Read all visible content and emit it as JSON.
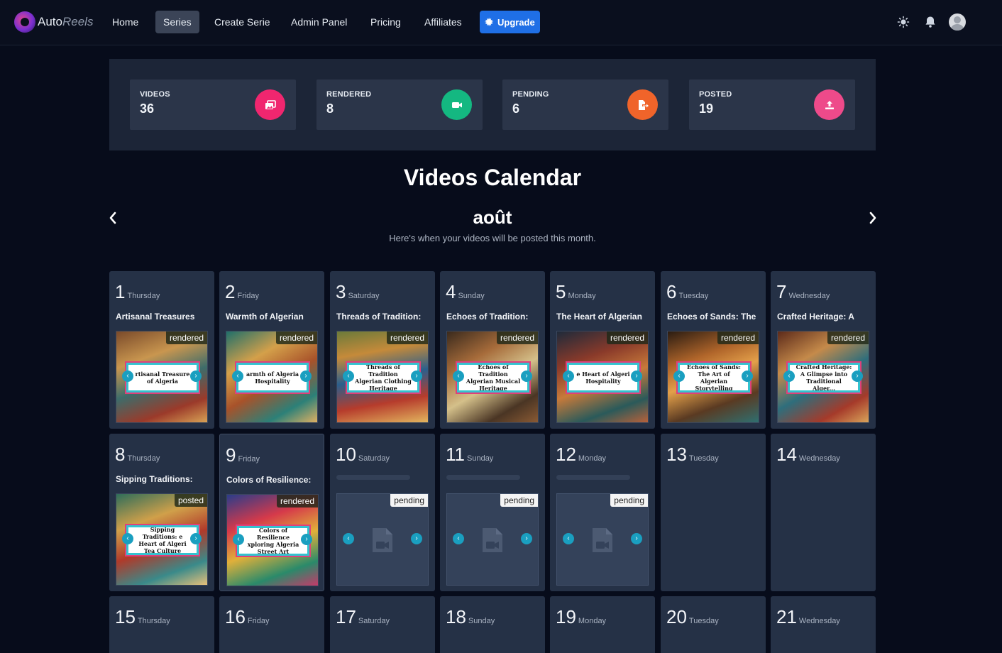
{
  "app": {
    "logo_main": "Auto",
    "logo_accent": "Reels"
  },
  "nav": {
    "items": [
      {
        "label": "Home",
        "active": false
      },
      {
        "label": "Series",
        "active": true
      },
      {
        "label": "Create Serie",
        "active": false
      },
      {
        "label": "Admin Panel",
        "active": false
      },
      {
        "label": "Pricing",
        "active": false
      },
      {
        "label": "Affiliates",
        "active": false
      }
    ],
    "upgrade_label": "Upgrade",
    "icons": [
      "sun-icon",
      "bell-icon",
      "avatar"
    ]
  },
  "stats": [
    {
      "label": "VIDEOS",
      "value": "36",
      "color": "#f0266f",
      "icon": "images-icon"
    },
    {
      "label": "RENDERED",
      "value": "8",
      "color": "#14b881",
      "icon": "video-icon"
    },
    {
      "label": "PENDING",
      "value": "6",
      "color": "#f0642a",
      "icon": "file-export-icon"
    },
    {
      "label": "POSTED",
      "value": "19",
      "color": "#ee4a8a",
      "icon": "upload-icon"
    }
  ],
  "calendar": {
    "title": "Videos Calendar",
    "month": "août",
    "subtitle": "Here's when your videos will be posted this month.",
    "days": [
      {
        "num": "1",
        "name": "Thursday",
        "title": "Artisanal Treasures",
        "status": "rendered",
        "caption": "rtisanal Treasure of Algeria"
      },
      {
        "num": "2",
        "name": "Friday",
        "title": "Warmth of Algerian",
        "status": "rendered",
        "caption": "armth of Algeria Hospitality"
      },
      {
        "num": "3",
        "name": "Saturday",
        "title": "Threads of Tradition:",
        "status": "rendered",
        "caption": "Threads of Tradition Algerian Clothing Heritage"
      },
      {
        "num": "4",
        "name": "Sunday",
        "title": "Echoes of Tradition:",
        "status": "rendered",
        "caption": "Echoes of Tradition Algerian Musical Heritage"
      },
      {
        "num": "5",
        "name": "Monday",
        "title": "The Heart of Algerian",
        "status": "rendered",
        "caption": "e Heart of Algeri Hospitality"
      },
      {
        "num": "6",
        "name": "Tuesday",
        "title": "Echoes of Sands: The",
        "status": "rendered",
        "caption": "Echoes of Sands: The Art of Algerian Storytelling"
      },
      {
        "num": "7",
        "name": "Wednesday",
        "title": "Crafted Heritage: A",
        "status": "rendered",
        "caption": "Crafted Heritage: A Glimpse into Traditional Alger..."
      },
      {
        "num": "8",
        "name": "Thursday",
        "title": "Sipping Traditions:",
        "status": "posted",
        "caption": "Sipping Traditions: e Heart of Algeri Tea Culture"
      },
      {
        "num": "9",
        "name": "Friday",
        "title": "Colors of Resilience:",
        "status": "rendered",
        "caption": "Colors of Resilience xploring Algeria Street Art"
      },
      {
        "num": "10",
        "name": "Saturday",
        "title": "",
        "status": "pending",
        "caption": ""
      },
      {
        "num": "11",
        "name": "Sunday",
        "title": "",
        "status": "pending",
        "caption": ""
      },
      {
        "num": "12",
        "name": "Monday",
        "title": "",
        "status": "pending",
        "caption": ""
      },
      {
        "num": "13",
        "name": "Tuesday",
        "title": "",
        "status": "",
        "caption": ""
      },
      {
        "num": "14",
        "name": "Wednesday",
        "title": "",
        "status": "",
        "caption": ""
      },
      {
        "num": "15",
        "name": "Thursday",
        "title": "",
        "status": "",
        "caption": ""
      },
      {
        "num": "16",
        "name": "Friday",
        "title": "",
        "status": "",
        "caption": ""
      },
      {
        "num": "17",
        "name": "Saturday",
        "title": "",
        "status": "",
        "caption": ""
      },
      {
        "num": "18",
        "name": "Sunday",
        "title": "",
        "status": "",
        "caption": ""
      },
      {
        "num": "19",
        "name": "Monday",
        "title": "",
        "status": "",
        "caption": ""
      },
      {
        "num": "20",
        "name": "Tuesday",
        "title": "",
        "status": "",
        "caption": ""
      },
      {
        "num": "21",
        "name": "Wednesday",
        "title": "",
        "status": "",
        "caption": ""
      }
    ]
  }
}
